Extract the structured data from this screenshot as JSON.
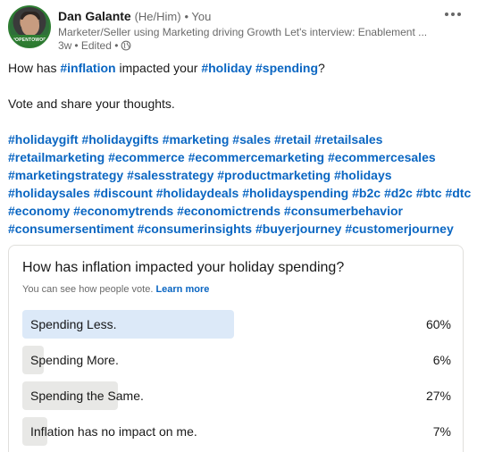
{
  "post": {
    "author": {
      "name": "Dan Galante",
      "pronouns": "(He/Him)",
      "you_label": "• You",
      "headline": "Marketer/Seller using Marketing driving Growth Let's interview: Enablement ...",
      "time": "3w",
      "edited": "• Edited •",
      "avatar_badge": "#OPENTOWORK"
    },
    "text": {
      "line1": {
        "pre": "How has ",
        "tag1": "#inflation",
        "mid": " impacted your ",
        "tag2": "#holiday",
        "space": " ",
        "tag3": "#spending",
        "post": "?"
      },
      "line2": "Vote and share your thoughts.",
      "hashtags": [
        "#holidaygift",
        "#holidaygifts",
        "#marketing",
        "#sales",
        "#retail",
        "#retailsales",
        "#retailmarketing",
        "#ecommerce",
        "#ecommercemarketing",
        "#ecommercesales",
        "#marketingstrategy",
        "#salesstrategy",
        "#productmarketing",
        "#holidays",
        "#holidaysales",
        "#discount",
        "#holidaydeals",
        "#holidayspending",
        "#b2c",
        "#d2c",
        "#btc",
        "#dtc",
        "#economy",
        "#economytrends",
        "#economictrends",
        "#consumerbehavior",
        "#consumersentiment",
        "#consumerinsights",
        "#buyerjourney",
        "#customerjourney"
      ]
    }
  },
  "poll": {
    "question": "How has inflation impacted your holiday spending?",
    "subtext": "You can see how people vote.",
    "learn_more": "Learn more",
    "options": [
      {
        "label": "Spending Less.",
        "percent": "60%",
        "fraction": 0.6,
        "selected": true
      },
      {
        "label": "Spending More.",
        "percent": "6%",
        "fraction": 0.06,
        "selected": false
      },
      {
        "label": "Spending the Same.",
        "percent": "27%",
        "fraction": 0.27,
        "selected": false
      },
      {
        "label": "Inflation has no impact on me.",
        "percent": "7%",
        "fraction": 0.07,
        "selected": false
      }
    ]
  },
  "icons": {
    "more": "more-horizontal-icon",
    "visibility": "globe-icon"
  },
  "colors": {
    "link": "#0a66c2",
    "selected_bar": "#dce9f8",
    "bar": "#e8e8e6"
  }
}
